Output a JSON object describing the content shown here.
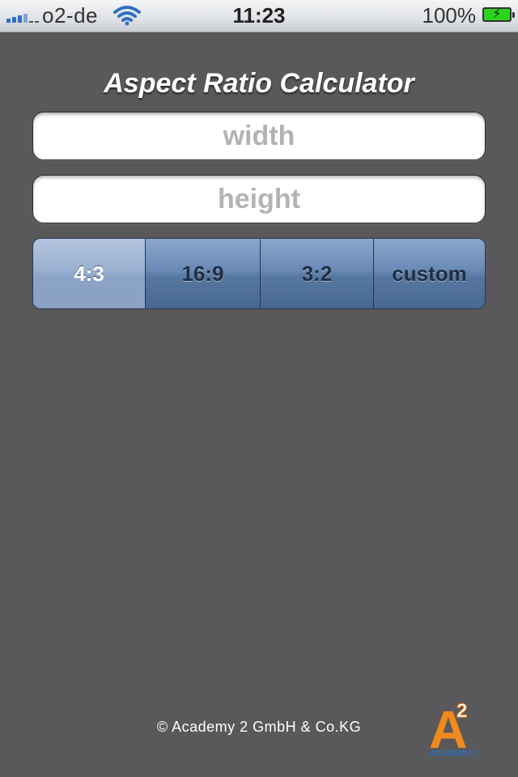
{
  "status_bar": {
    "carrier": "o2-de",
    "time": "11:23",
    "battery_percent": "100%",
    "signal_icon": "signal-bars-icon",
    "wifi_icon": "wifi-icon",
    "battery_icon": "battery-charging-icon"
  },
  "app": {
    "title": "Aspect Ratio Calculator"
  },
  "inputs": {
    "width": {
      "value": "",
      "placeholder": "width"
    },
    "height": {
      "value": "",
      "placeholder": "height"
    }
  },
  "ratio_selector": {
    "selected_index": 0,
    "options": [
      "4:3",
      "16:9",
      "3:2",
      "custom"
    ]
  },
  "footer": {
    "copyright": "© Academy 2 GmbH & Co.KG",
    "logo_text": "ACADEMY 2",
    "logo_letter": "A",
    "logo_superscript": "2"
  },
  "colors": {
    "background": "#59585a",
    "segment": "#5a7aa3",
    "segment_selected": "#9bb1d1",
    "logo": "#f08a1c",
    "logo_text": "#2b6fc0",
    "battery": "#2bd51e"
  }
}
